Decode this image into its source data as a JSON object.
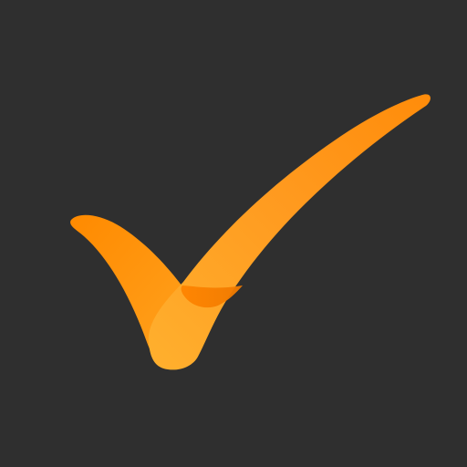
{
  "icon": {
    "name": "checkmark-icon",
    "background_color": "#2f2f2f",
    "primary_color": "#ff9a1f",
    "shadow_color": "#f07d00",
    "highlight_color": "#ffab3a"
  }
}
